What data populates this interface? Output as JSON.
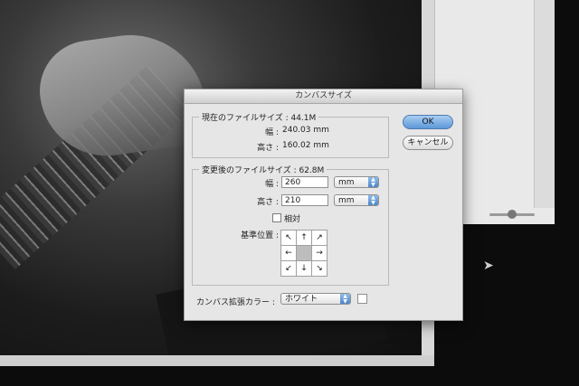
{
  "dialog": {
    "title": "カンバスサイズ",
    "current": {
      "legend": "現在のファイルサイズ : 44.1M",
      "width_label": "幅 :",
      "width_value": "240.03 mm",
      "height_label": "高さ :",
      "height_value": "160.02 mm"
    },
    "new": {
      "legend": "変更後のファイルサイズ : 62.8M",
      "width_label": "幅 :",
      "width_value": "260",
      "width_unit": "mm",
      "height_label": "高さ :",
      "height_value": "210",
      "height_unit": "mm",
      "relative_label": "相対",
      "relative_checked": false,
      "anchor_label": "基準位置 :",
      "anchor_arrows": [
        "↖",
        "↑",
        "↗",
        "←",
        "",
        "→",
        "↙",
        "↓",
        "↘"
      ]
    },
    "extension": {
      "label": "カンバス拡張カラー :",
      "value": "ホワイト"
    },
    "ok_label": "OK",
    "cancel_label": "キャンセル"
  },
  "colors": {
    "ok_button": "#5c98d8",
    "dialog_bg": "#e6e6e6",
    "swatch": "#ffffff"
  },
  "icons": [
    "anchor-arrow-icons",
    "select-arrow-icon",
    "mouse-cursor-icon"
  ]
}
